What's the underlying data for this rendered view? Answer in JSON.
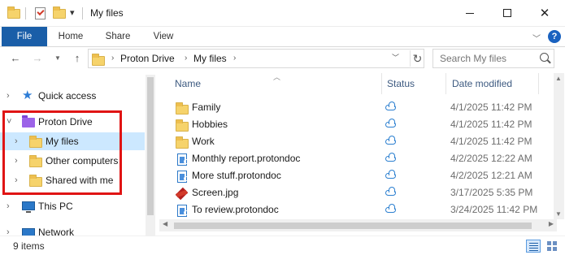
{
  "window": {
    "title": "My files"
  },
  "ribbon": {
    "tabs": [
      "File",
      "Home",
      "Share",
      "View"
    ]
  },
  "address": {
    "path": [
      "Proton Drive",
      "My files"
    ]
  },
  "search": {
    "placeholder": "Search My files"
  },
  "nav_pane": {
    "items": [
      {
        "label": "Quick access",
        "icon": "star-icon"
      },
      {
        "label": "Proton Drive",
        "icon": "proton-drive-icon"
      },
      {
        "label": "My files",
        "icon": "folder-icon"
      },
      {
        "label": "Other computers",
        "icon": "folder-icon"
      },
      {
        "label": "Shared with me",
        "icon": "folder-icon"
      },
      {
        "label": "This PC",
        "icon": "computer-icon"
      },
      {
        "label": "Network",
        "icon": "network-icon"
      }
    ]
  },
  "columns": {
    "name": "Name",
    "status": "Status",
    "date_modified": "Date modified"
  },
  "files": [
    {
      "name": "Family",
      "type": "folder",
      "status": "cloud",
      "date": "4/1/2025 11:42 PM"
    },
    {
      "name": "Hobbies",
      "type": "folder",
      "status": "cloud",
      "date": "4/1/2025 11:42 PM"
    },
    {
      "name": "Work",
      "type": "folder",
      "status": "cloud",
      "date": "4/1/2025 11:42 PM"
    },
    {
      "name": "Monthly report.protondoc",
      "type": "doc",
      "status": "cloud",
      "date": "4/2/2025 12:22 AM"
    },
    {
      "name": "More stuff.protondoc",
      "type": "doc",
      "status": "cloud",
      "date": "4/2/2025 12:21 AM"
    },
    {
      "name": "Screen.jpg",
      "type": "image",
      "status": "cloud",
      "date": "3/17/2025 5:35 PM"
    },
    {
      "name": "To review.protondoc",
      "type": "doc",
      "status": "cloud",
      "date": "3/24/2025 11:42 PM"
    }
  ],
  "status_bar": {
    "item_count": "9 items"
  },
  "colors": {
    "accent": "#1a5ea8",
    "selection": "#cce8ff",
    "highlight_border": "#e01414",
    "proton_purple": "#9c63e8"
  }
}
